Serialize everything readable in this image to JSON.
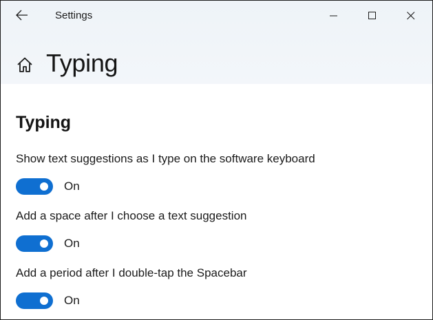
{
  "window": {
    "title": "Settings"
  },
  "page": {
    "title": "Typing"
  },
  "section": {
    "title": "Typing"
  },
  "settings": [
    {
      "label": "Show text suggestions as I type on the software keyboard",
      "state": "On",
      "enabled": true
    },
    {
      "label": "Add a space after I choose a text suggestion",
      "state": "On",
      "enabled": true
    },
    {
      "label": "Add a period after I double-tap the Spacebar",
      "state": "On",
      "enabled": true
    }
  ],
  "colors": {
    "accent": "#0f6fd1",
    "header_bg": "#eef3f8",
    "text": "#1a1a1a"
  },
  "icons": {
    "back": "arrow-left",
    "home": "home",
    "minimize": "minimize",
    "maximize": "maximize",
    "close": "close"
  }
}
